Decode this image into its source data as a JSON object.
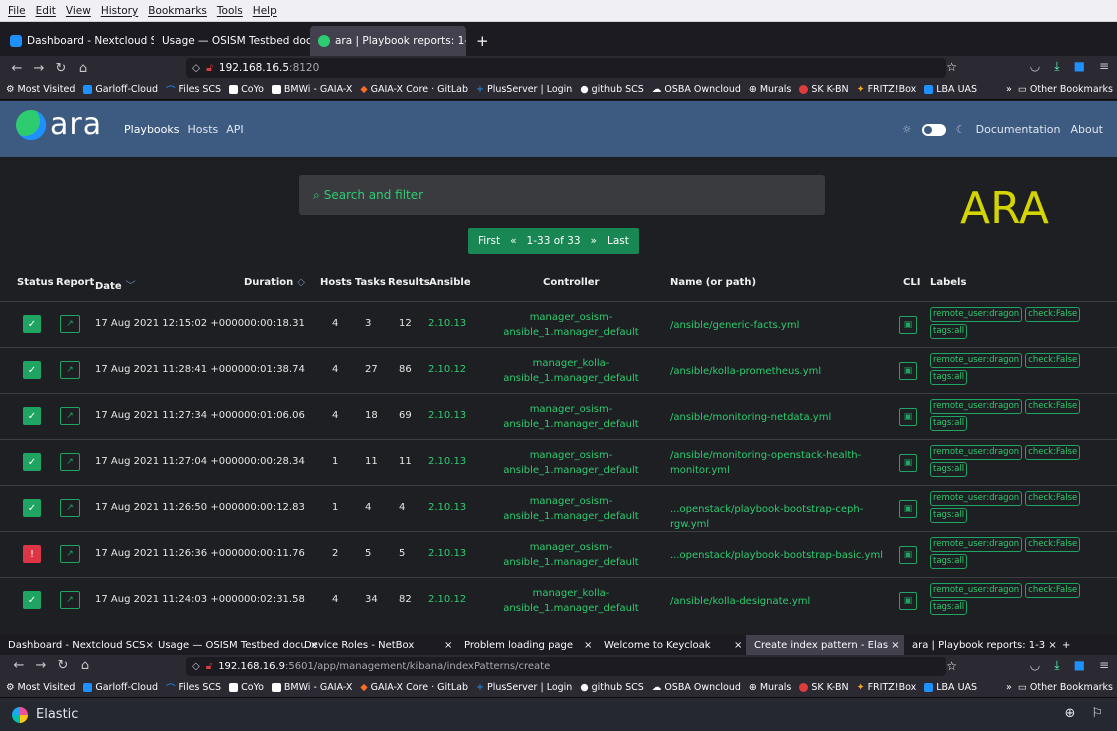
{
  "browser": {
    "menu": [
      "File",
      "Edit",
      "View",
      "History",
      "Bookmarks",
      "Tools",
      "Help"
    ],
    "tabs": [
      {
        "label": "Dashboard - Nextcloud SCS",
        "active": false,
        "color": "#1e90ff"
      },
      {
        "label": "Usage — OSISM Testbed docu",
        "active": false,
        "color": ""
      },
      {
        "label": "ara | Playbook reports: 1-3",
        "active": true,
        "color": "#2ecc71"
      }
    ],
    "url_host": "192.168.16.5",
    "url_port": ":8120",
    "bookmarks": [
      "Most Visited",
      "Garloff-Cloud",
      "Files SCS",
      "CoYo",
      "BMWi - GAIA-X",
      "GAIA-X Core · GitLab",
      "PlusServer | Login",
      "github SCS",
      "OSBA Owncloud",
      "Murals",
      "SK K-BN",
      "FRITZ!Box",
      "LBA UAS"
    ],
    "other_bookmarks": "Other Bookmarks"
  },
  "ara": {
    "brand": "ara",
    "nav": [
      "Playbooks",
      "Hosts",
      "API"
    ],
    "right_links": [
      "Documentation",
      "About"
    ],
    "search_placeholder": "Search and filter",
    "big_title": "ARA",
    "pager": {
      "first": "First",
      "prev": "«",
      "range": "1-33 of 33",
      "next": "»",
      "last": "Last"
    },
    "columns": {
      "status": "Status",
      "report": "Report",
      "date": "Date",
      "duration": "Duration",
      "hosts": "Hosts",
      "tasks": "Tasks",
      "results": "Results",
      "ansible": "Ansible",
      "controller": "Controller",
      "name": "Name (or path)",
      "cli": "CLI",
      "labels": "Labels"
    },
    "rows": [
      {
        "status": "ok",
        "date": "17 Aug 2021 12:15:02 +0000",
        "duration": "00:00:18.31",
        "hosts": "4",
        "tasks": "3",
        "results": "12",
        "ansible": "2.10.13",
        "controller": "manager_osism-ansible_1.manager_default",
        "name": "/ansible/generic-facts.yml",
        "labels": [
          "remote_user:dragon",
          "check:False",
          "tags:all"
        ]
      },
      {
        "status": "ok",
        "date": "17 Aug 2021 11:28:41 +0000",
        "duration": "00:01:38.74",
        "hosts": "4",
        "tasks": "27",
        "results": "86",
        "ansible": "2.10.12",
        "controller": "manager_kolla-ansible_1.manager_default",
        "name": "/ansible/kolla-prometheus.yml",
        "labels": [
          "remote_user:dragon",
          "check:False",
          "tags:all"
        ]
      },
      {
        "status": "ok",
        "date": "17 Aug 2021 11:27:34 +0000",
        "duration": "00:01:06.06",
        "hosts": "4",
        "tasks": "18",
        "results": "69",
        "ansible": "2.10.13",
        "controller": "manager_osism-ansible_1.manager_default",
        "name": "/ansible/monitoring-netdata.yml",
        "labels": [
          "remote_user:dragon",
          "check:False",
          "tags:all"
        ]
      },
      {
        "status": "ok",
        "date": "17 Aug 2021 11:27:04 +0000",
        "duration": "00:00:28.34",
        "hosts": "1",
        "tasks": "11",
        "results": "11",
        "ansible": "2.10.13",
        "controller": "manager_osism-ansible_1.manager_default",
        "name": "/ansible/monitoring-openstack-health-monitor.yml",
        "labels": [
          "remote_user:dragon",
          "check:False",
          "tags:all"
        ]
      },
      {
        "status": "ok",
        "date": "17 Aug 2021 11:26:50 +0000",
        "duration": "00:00:12.83",
        "hosts": "1",
        "tasks": "4",
        "results": "4",
        "ansible": "2.10.13",
        "controller": "manager_osism-ansible_1.manager_default",
        "name": "...openstack/playbook-bootstrap-ceph-rgw.yml",
        "labels": [
          "remote_user:dragon",
          "check:False",
          "tags:all"
        ]
      },
      {
        "status": "fail",
        "date": "17 Aug 2021 11:26:36 +0000",
        "duration": "00:00:11.76",
        "hosts": "2",
        "tasks": "5",
        "results": "5",
        "ansible": "2.10.13",
        "controller": "manager_osism-ansible_1.manager_default",
        "name": "...openstack/playbook-bootstrap-basic.yml",
        "labels": [
          "remote_user:dragon",
          "check:False",
          "tags:all"
        ]
      },
      {
        "status": "ok",
        "date": "17 Aug 2021 11:24:03 +0000",
        "duration": "00:02:31.58",
        "hosts": "4",
        "tasks": "34",
        "results": "82",
        "ansible": "2.10.12",
        "controller": "manager_kolla-ansible_1.manager_default",
        "name": "/ansible/kolla-designate.yml",
        "labels": [
          "remote_user:dragon",
          "check:False",
          "tags:all"
        ]
      }
    ]
  },
  "second_window": {
    "tabs": [
      "Dashboard - Nextcloud SCS×",
      "Usage — OSISM Testbed docu ×",
      "Device Roles - NetBox",
      "×",
      "Problem loading page",
      "×",
      "Welcome to Keycloak",
      "×",
      "Create index pattern - Elas ×",
      "ara | Playbook reports: 1-3 ×",
      "+"
    ],
    "url_host": "192.168.16.9",
    "url_path": ":5601/app/management/kibana/indexPatterns/create",
    "app_title": "Elastic"
  },
  "colors": {
    "header": "#3d5a80",
    "accent_green": "#2ecc71",
    "ok": "#1fa463",
    "fail": "#dc3545",
    "ara_big": "#d4d400"
  }
}
